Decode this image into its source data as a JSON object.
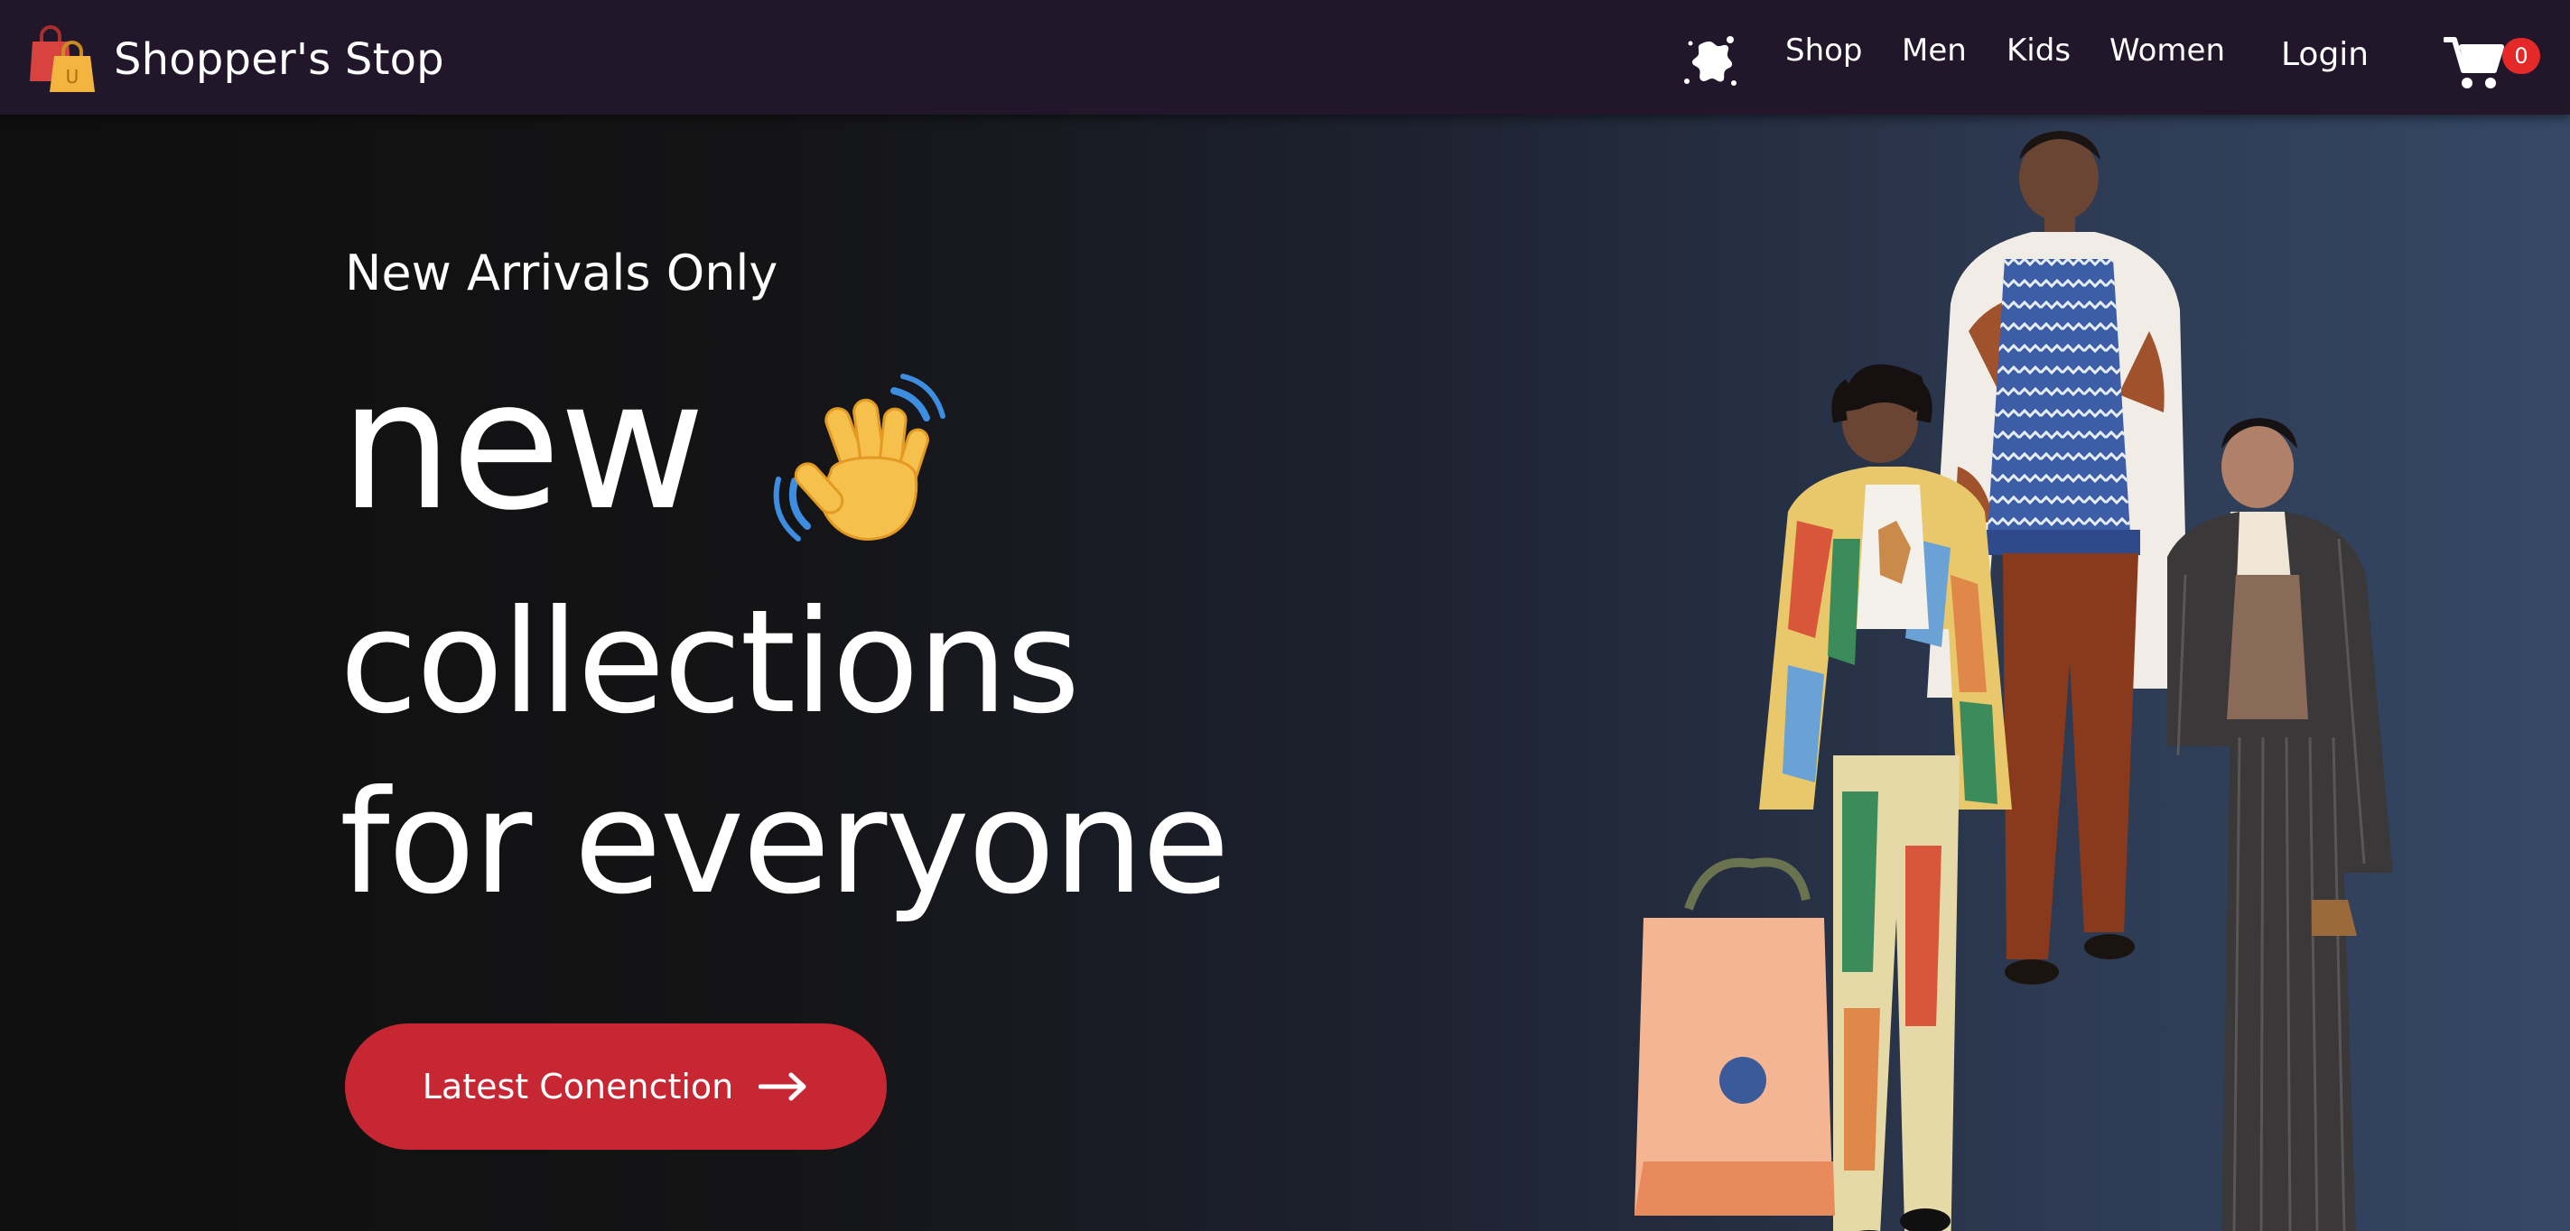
{
  "brand": {
    "name": "Shopper's Stop",
    "logo_icon": "shopping-bags-icon",
    "logo_letter": "U"
  },
  "nav": {
    "theme_icon": "theme-splash-icon",
    "links": [
      "Shop",
      "Men",
      "Kids",
      "Women"
    ],
    "login_label": "Login",
    "cart_icon": "cart-icon",
    "cart_count": "0"
  },
  "hero": {
    "eyebrow": "New Arrivals Only",
    "line1": "new",
    "line2": "collections",
    "line3": "for everyone",
    "wave_icon": "waving-hand-icon",
    "cta_label": "Latest Conenction",
    "cta_icon": "arrow-right-icon",
    "image": "fashion-models-image"
  },
  "colors": {
    "navbar": "#21162a",
    "accent": "#c72733",
    "badge": "#e52929",
    "hero_left": "#0f0f0f",
    "hero_right": "#354866"
  }
}
